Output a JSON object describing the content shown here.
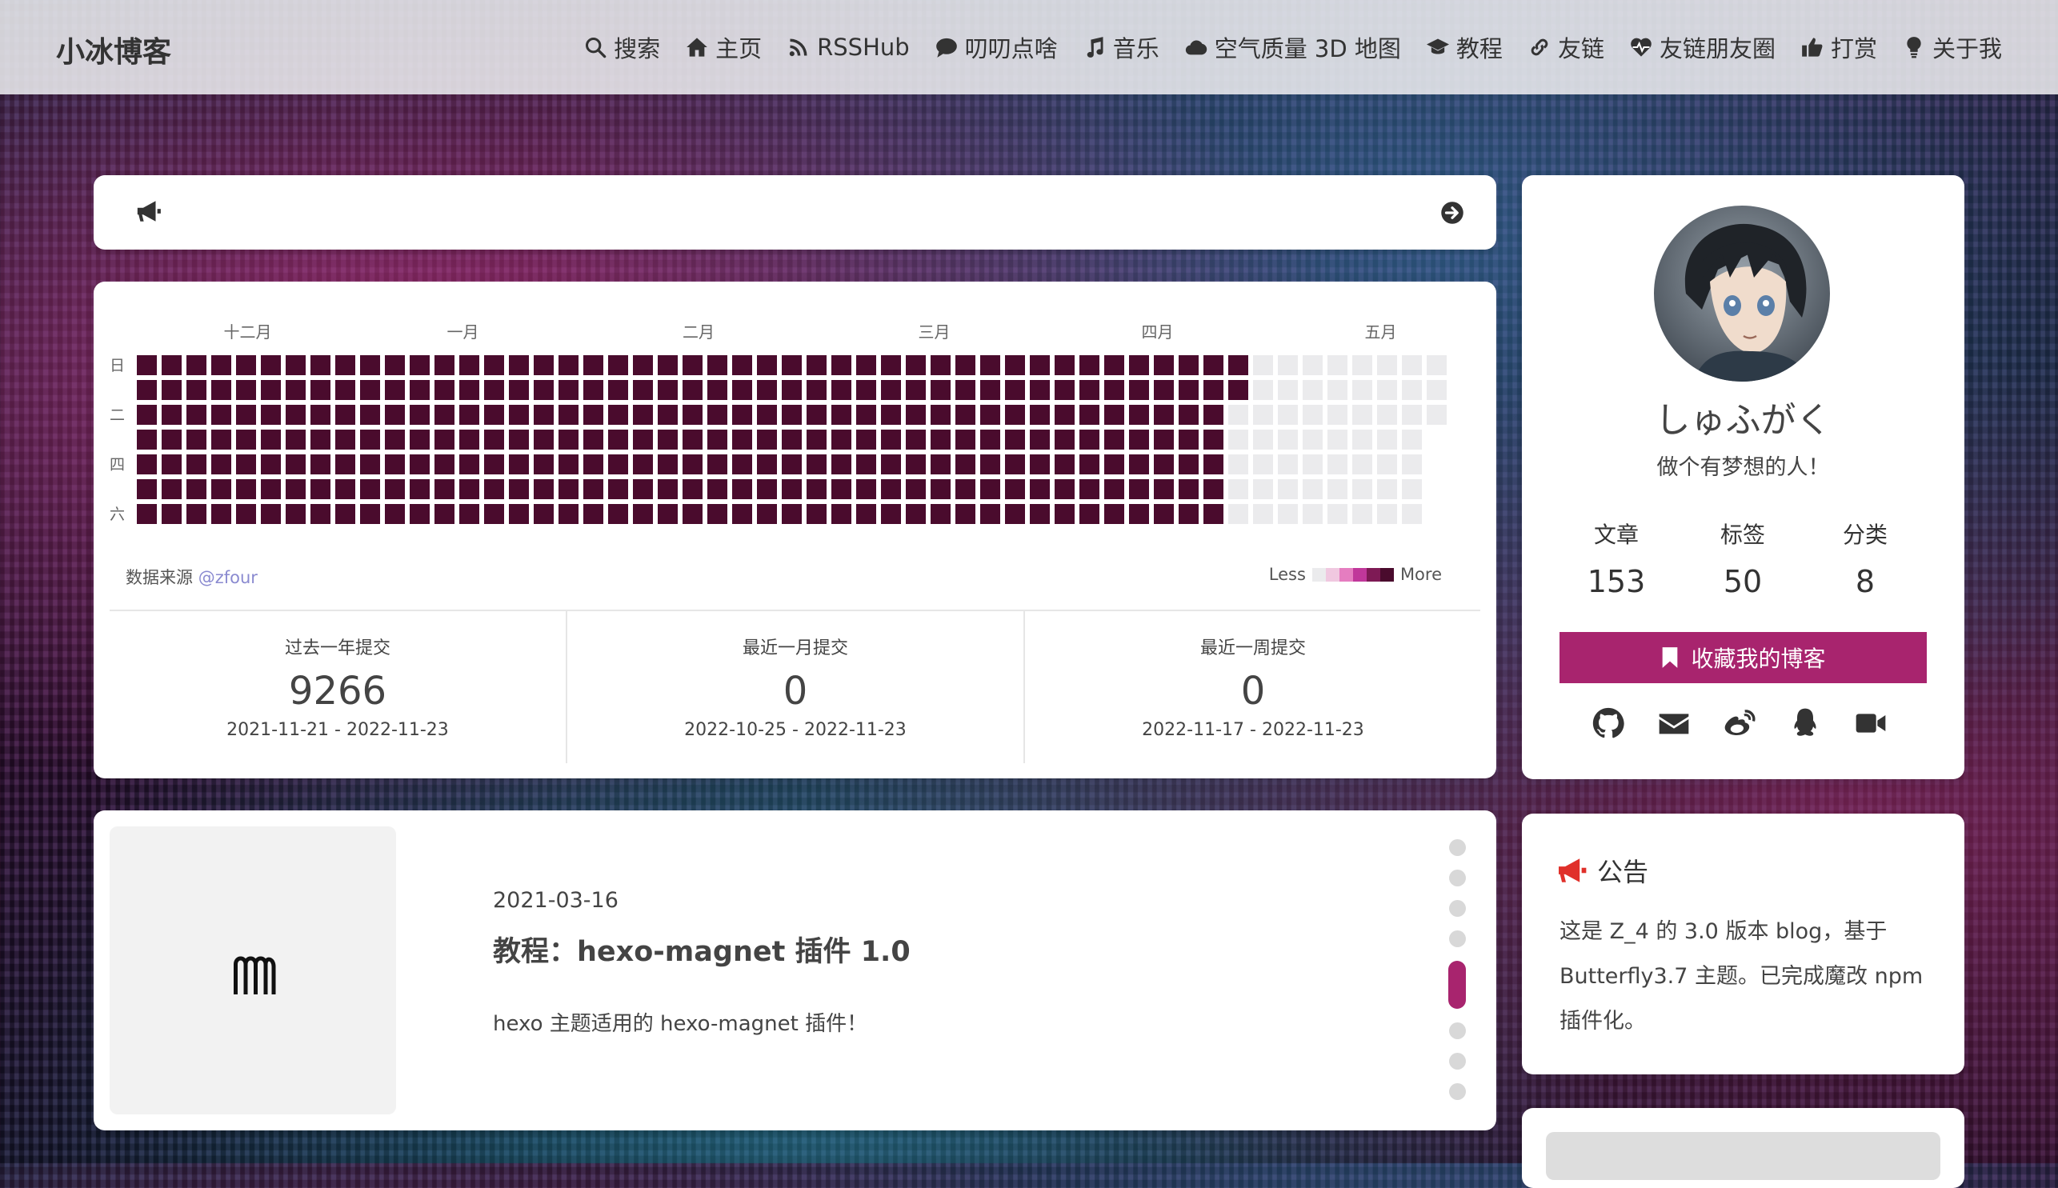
{
  "nav": {
    "title": "小冰博客",
    "items": [
      {
        "label": "搜索",
        "icon": "search-icon"
      },
      {
        "label": "主页",
        "icon": "home-icon"
      },
      {
        "label": "RSSHub",
        "icon": "rss-icon"
      },
      {
        "label": "叨叨点啥",
        "icon": "comment-icon"
      },
      {
        "label": "音乐",
        "icon": "music-icon"
      },
      {
        "label": "空气质量 3D 地图",
        "icon": "cloud-icon"
      },
      {
        "label": "教程",
        "icon": "graduation-cap-icon"
      },
      {
        "label": "友链",
        "icon": "link-icon"
      },
      {
        "label": "友链朋友圈",
        "icon": "heartbeat-icon"
      },
      {
        "label": "打赏",
        "icon": "thumbs-up-icon"
      },
      {
        "label": "关于我",
        "icon": "lightbulb-icon"
      }
    ]
  },
  "calendar": {
    "months": [
      "十二月",
      "一月",
      "二月",
      "三月",
      "四月",
      "五月"
    ],
    "weekdays": [
      "日",
      "二",
      "四",
      "六"
    ],
    "source_label": "数据来源",
    "source_handle": "@zfour",
    "legend_less": "Less",
    "legend_more": "More",
    "colors": {
      "empty": "#ebebed",
      "full": "#4a0b2d",
      "l1": "#f0c8e0",
      "l2": "#e57dc0",
      "l3": "#c0379a",
      "l4": "#7e1a55"
    },
    "stats": [
      {
        "label": "过去一年提交",
        "value": "9266",
        "range": "2021-11-21 - 2022-11-23"
      },
      {
        "label": "最近一月提交",
        "value": "0",
        "range": "2022-10-25 - 2022-11-23"
      },
      {
        "label": "最近一周提交",
        "value": "0",
        "range": "2022-11-17 - 2022-11-23"
      }
    ]
  },
  "post": {
    "date": "2021-03-16",
    "title": "教程：hexo-magnet 插件 1.0",
    "excerpt": "hexo 主题适用的 hexo-magnet 插件！"
  },
  "profile": {
    "name": "しゅふがく",
    "description": "做个有梦想的人！",
    "stats": [
      {
        "label": "文章",
        "value": "153"
      },
      {
        "label": "标签",
        "value": "50"
      },
      {
        "label": "分类",
        "value": "8"
      }
    ],
    "bookmark_label": "收藏我的博客",
    "social": [
      "github-icon",
      "email-icon",
      "weibo-icon",
      "qq-icon",
      "video-icon"
    ],
    "accent": "#a8246e"
  },
  "announcement": {
    "title": "公告",
    "text": "这是 Z_4 的 3.0 版本 blog，基于 Butterfly3.7 主题。已完成魔改 npm 插件化。"
  }
}
